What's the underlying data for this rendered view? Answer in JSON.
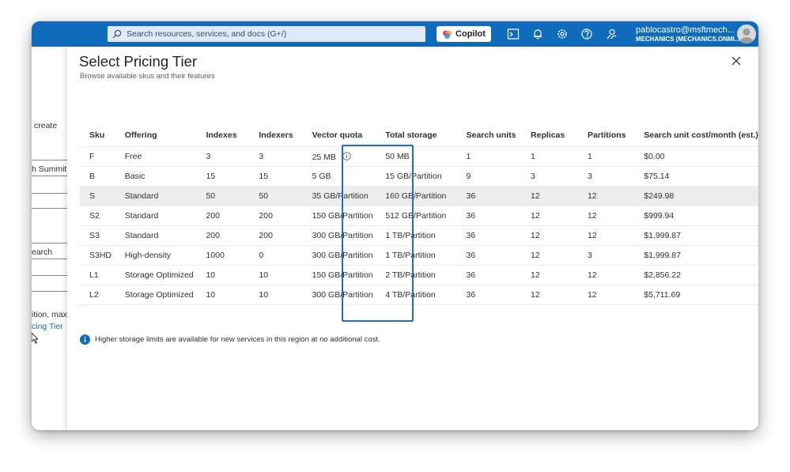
{
  "topbar": {
    "search_placeholder": "Search resources, services, and docs (G+/)",
    "copilot_label": "Copilot",
    "user_name": "pablocastro@msftmech...",
    "user_org": "MECHANICS (MECHANICS.ONMI...",
    "icons": [
      "cloud-shell-icon",
      "bell-icon",
      "gear-icon",
      "help-icon",
      "feedback-icon"
    ]
  },
  "left_panel": {
    "fragments": [
      "create",
      "h Summit",
      "earch",
      "ition, max",
      "cing Tier"
    ]
  },
  "blade": {
    "title": "Select Pricing Tier",
    "subtitle": "Browse available skus and their features",
    "table": {
      "headers": [
        "Sku",
        "Offering",
        "Indexes",
        "Indexers",
        "Vector quota",
        "Total storage",
        "Search units",
        "Replicas",
        "Partitions",
        "Search unit cost/month (est.)"
      ],
      "rows": [
        [
          "F",
          "Free",
          "3",
          "3",
          "25 MB",
          "50 MB",
          "1",
          "1",
          "1",
          "$0.00"
        ],
        [
          "B",
          "Basic",
          "15",
          "15",
          "5 GB",
          "15 GB/Partition",
          "9",
          "3",
          "3",
          "$75.14"
        ],
        [
          "S",
          "Standard",
          "50",
          "50",
          "35 GB/Partition",
          "160 GB/Partition",
          "36",
          "12",
          "12",
          "$249.98"
        ],
        [
          "S2",
          "Standard",
          "200",
          "200",
          "150 GB/Partition",
          "512 GB/Partition",
          "36",
          "12",
          "12",
          "$999.94"
        ],
        [
          "S3",
          "Standard",
          "200",
          "200",
          "300 GB/Partition",
          "1 TB/Partition",
          "36",
          "12",
          "12",
          "$1,999.87"
        ],
        [
          "S3HD",
          "High-density",
          "1000",
          "0",
          "300 GB/Partition",
          "1 TB/Partition",
          "36",
          "12",
          "3",
          "$1,999.87"
        ],
        [
          "L1",
          "Storage Optimized",
          "10",
          "10",
          "150 GB/Partition",
          "2 TB/Partition",
          "36",
          "12",
          "12",
          "$2,856.22"
        ],
        [
          "L2",
          "Storage Optimized",
          "10",
          "10",
          "300 GB/Partition",
          "4 TB/Partition",
          "36",
          "12",
          "12",
          "$5,711.69"
        ]
      ],
      "selected_row": 2,
      "highlighted_column": "Vector quota"
    },
    "info_message": "Higher storage limits are available for new services in this region at no additional cost."
  },
  "colors": {
    "topbar": "#0f6cbd",
    "highlight_border": "#1b6fd1",
    "selected_row": "#ededed",
    "info_icon": "#0f6cbd"
  }
}
